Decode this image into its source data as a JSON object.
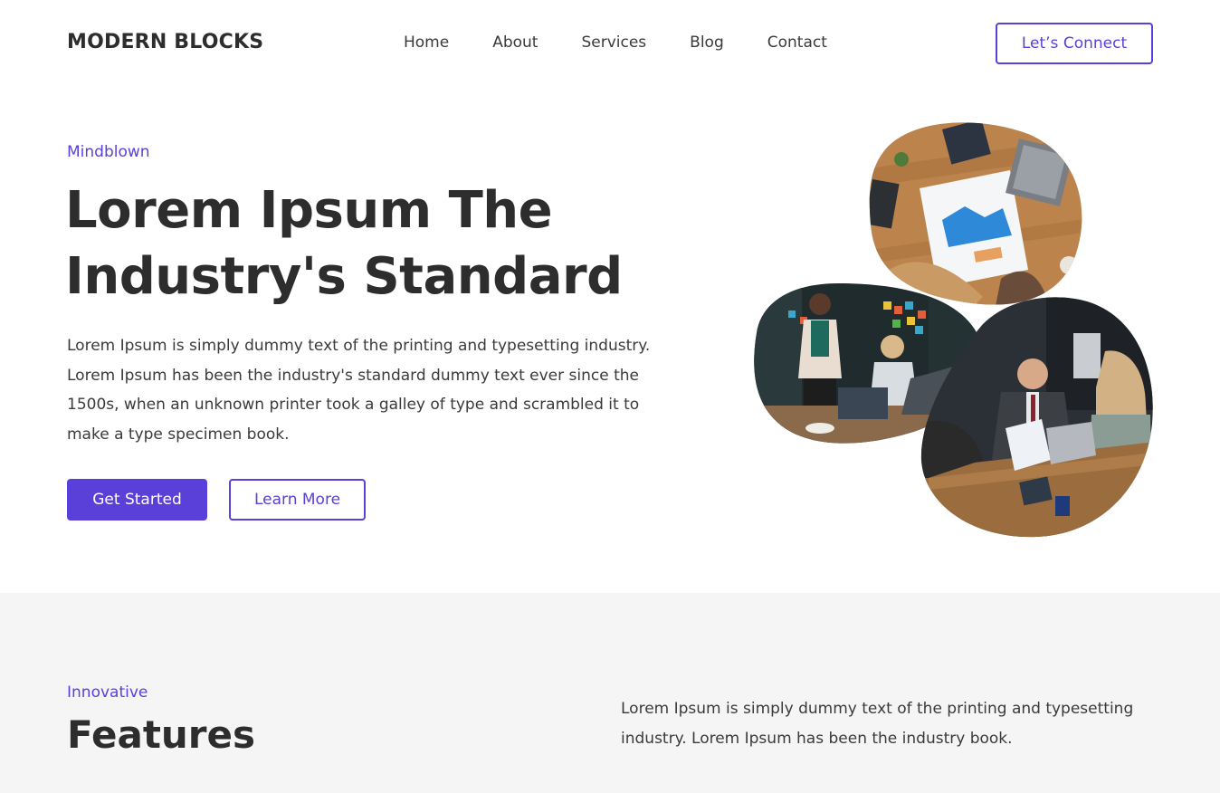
{
  "header": {
    "logo": "MODERN BLOCKS",
    "nav": [
      "Home",
      "About",
      "Services",
      "Blog",
      "Contact"
    ],
    "cta": "Let’s Connect"
  },
  "hero": {
    "eyebrow": "Mindblown",
    "title": "Lorem Ipsum The Industry's Standard",
    "description": "Lorem Ipsum is simply dummy text of the printing and typesetting industry. Lorem Ipsum has been the industry's standard dummy text ever since the 1500s, when an unknown printer took a galley of type and scrambled it to make a type specimen book.",
    "primary_button": "Get Started",
    "secondary_button": "Learn More"
  },
  "features": {
    "eyebrow": "Innovative",
    "title": "Features",
    "description": "Lorem Ipsum is simply dummy text of the printing and typesetting industry. Lorem Ipsum has been the industry book."
  },
  "colors": {
    "accent": "#5b3fd9",
    "text": "#2d2d2d",
    "section_bg": "#f5f5f5"
  }
}
